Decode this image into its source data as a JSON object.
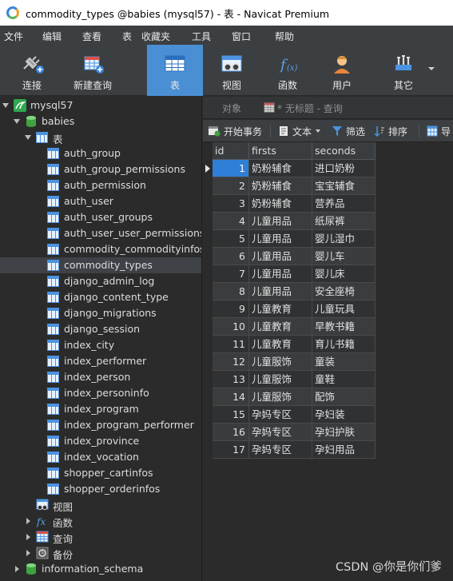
{
  "window": {
    "title": "commodity_types @babies (mysql57) - 表 - Navicat Premium"
  },
  "menu": [
    "文件",
    "编辑",
    "查看",
    "表",
    "收藏夹",
    "工具",
    "窗口",
    "帮助"
  ],
  "toolbar": {
    "connect": "连接",
    "new_query": "新建查询",
    "table": "表",
    "view": "视图",
    "function": "函数",
    "user": "用户",
    "other": "其它"
  },
  "sidebar": {
    "connection": "mysql57",
    "database": "babies",
    "tables_group": "表",
    "tables": [
      "auth_group",
      "auth_group_permissions",
      "auth_permission",
      "auth_user",
      "auth_user_groups",
      "auth_user_user_permissions",
      "commodity_commodityinfos",
      "commodity_types",
      "django_admin_log",
      "django_content_type",
      "django_migrations",
      "django_session",
      "index_city",
      "index_performer",
      "index_person",
      "index_personinfo",
      "index_program",
      "index_program_performer",
      "index_province",
      "index_vocation",
      "shopper_cartinfos",
      "shopper_orderinfos"
    ],
    "selected_table": "commodity_types",
    "views_group": "视图",
    "functions_group": "函数",
    "queries_group": "查询",
    "backups_group": "备份",
    "other_database": "information_schema"
  },
  "tabs": {
    "objects": "对象",
    "untitled_query": "* 无标题 - 查询"
  },
  "subtoolbar": {
    "begin_transaction": "开始事务",
    "text": "文本",
    "filter": "筛选",
    "sort": "排序",
    "import": "导"
  },
  "grid": {
    "columns": [
      "id",
      "firsts",
      "seconds"
    ],
    "rows": [
      [
        "1",
        "奶粉辅食",
        "进口奶粉"
      ],
      [
        "2",
        "奶粉辅食",
        "宝宝辅食"
      ],
      [
        "3",
        "奶粉辅食",
        "营养品"
      ],
      [
        "4",
        "儿童用品",
        "纸尿裤"
      ],
      [
        "5",
        "儿童用品",
        "婴儿湿巾"
      ],
      [
        "6",
        "儿童用品",
        "婴儿车"
      ],
      [
        "7",
        "儿童用品",
        "婴儿床"
      ],
      [
        "8",
        "儿童用品",
        "安全座椅"
      ],
      [
        "9",
        "儿童教育",
        "儿童玩具"
      ],
      [
        "10",
        "儿童教育",
        "早教书籍"
      ],
      [
        "11",
        "儿童教育",
        "育儿书籍"
      ],
      [
        "12",
        "儿童服饰",
        "童装"
      ],
      [
        "13",
        "儿童服饰",
        "童鞋"
      ],
      [
        "14",
        "儿童服饰",
        "配饰"
      ],
      [
        "15",
        "孕妈专区",
        "孕妇装"
      ],
      [
        "16",
        "孕妈专区",
        "孕妇护肤"
      ],
      [
        "17",
        "孕妈专区",
        "孕妇用品"
      ]
    ]
  },
  "watermark": "CSDN @你是你们爹",
  "colors": {
    "accent": "#4a8fd4",
    "selected_cell": "#2f7fd6",
    "background": "#2b2b2b"
  }
}
